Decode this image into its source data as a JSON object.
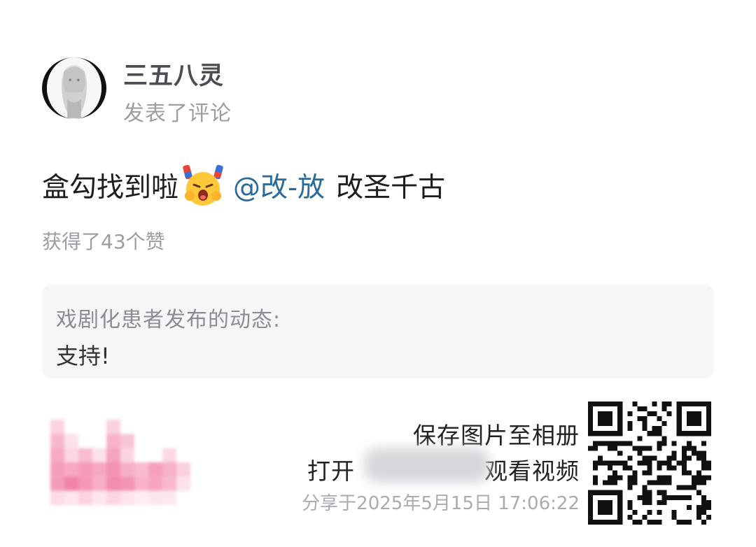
{
  "post": {
    "user": {
      "name": "三五八灵",
      "action": "发表了评论"
    },
    "comment": {
      "text_before": "盒勾找到啦",
      "emoji": "crying-face-emoji",
      "mention": "@改-放",
      "text_after": "改圣千古"
    },
    "likes_text": "获得了43个赞",
    "quoted": {
      "author_line": "戏剧化患者发布的动态:",
      "text": "支持!"
    }
  },
  "share_footer": {
    "save_hint": "保存图片至相册",
    "open_hint_start": "打开",
    "open_hint_end": "观看视频",
    "share_time": "分享于2025年5月15日 17:06:22",
    "qr": "qr-code-icon"
  },
  "colors": {
    "mention": "#2b6b9b",
    "card_bg": "#f5f6f7",
    "muted": "#9a9da3"
  }
}
